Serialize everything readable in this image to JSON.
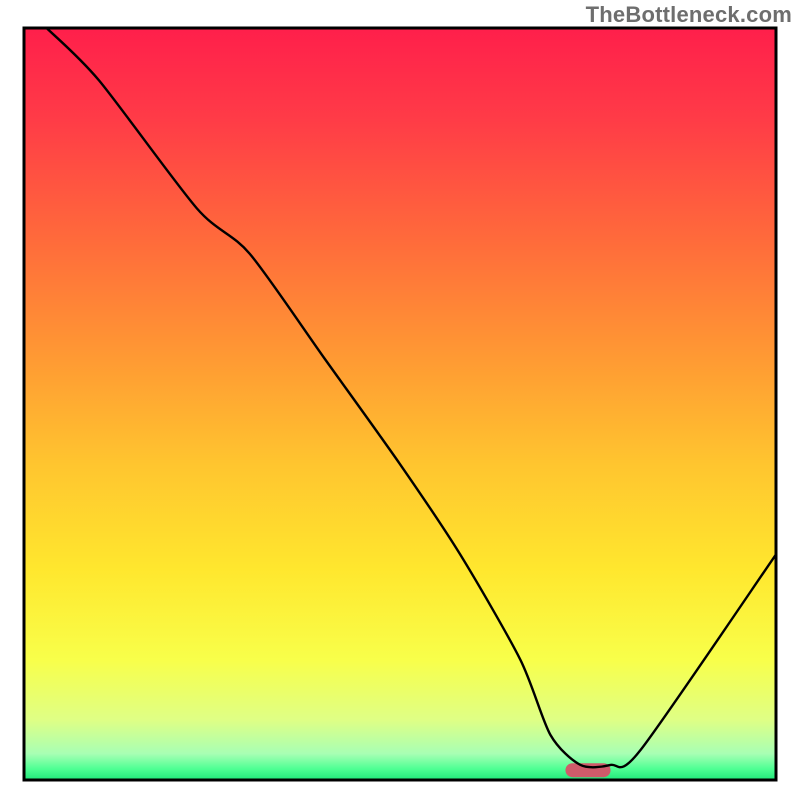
{
  "watermark": "TheBottleneck.com",
  "chart_data": {
    "type": "line",
    "title": "",
    "xlabel": "",
    "ylabel": "",
    "xlim": [
      0,
      100
    ],
    "ylim": [
      0,
      100
    ],
    "series": [
      {
        "name": "bottleneck-curve",
        "x": [
          3,
          10,
          23,
          30,
          40,
          50,
          58,
          66,
          70,
          74,
          78,
          82,
          100
        ],
        "values": [
          100,
          93,
          76,
          70,
          56,
          42,
          30,
          16,
          6,
          2,
          2,
          4,
          30
        ]
      }
    ],
    "marker": {
      "name": "optimal-range",
      "x_start": 72,
      "x_end": 78,
      "y": 1.3,
      "color": "#cf5b6a"
    },
    "gradient_stops": [
      {
        "offset": 0.0,
        "color": "#ff1f4b"
      },
      {
        "offset": 0.12,
        "color": "#ff3b47"
      },
      {
        "offset": 0.28,
        "color": "#ff6a3b"
      },
      {
        "offset": 0.44,
        "color": "#ff9a33"
      },
      {
        "offset": 0.58,
        "color": "#ffc52f"
      },
      {
        "offset": 0.72,
        "color": "#ffe72e"
      },
      {
        "offset": 0.84,
        "color": "#f8ff4a"
      },
      {
        "offset": 0.92,
        "color": "#dfff85"
      },
      {
        "offset": 0.965,
        "color": "#a8ffb4"
      },
      {
        "offset": 0.985,
        "color": "#4fff94"
      },
      {
        "offset": 1.0,
        "color": "#20e87a"
      }
    ],
    "frame_color": "#000000",
    "line_color": "#000000",
    "line_width": 2.4
  }
}
